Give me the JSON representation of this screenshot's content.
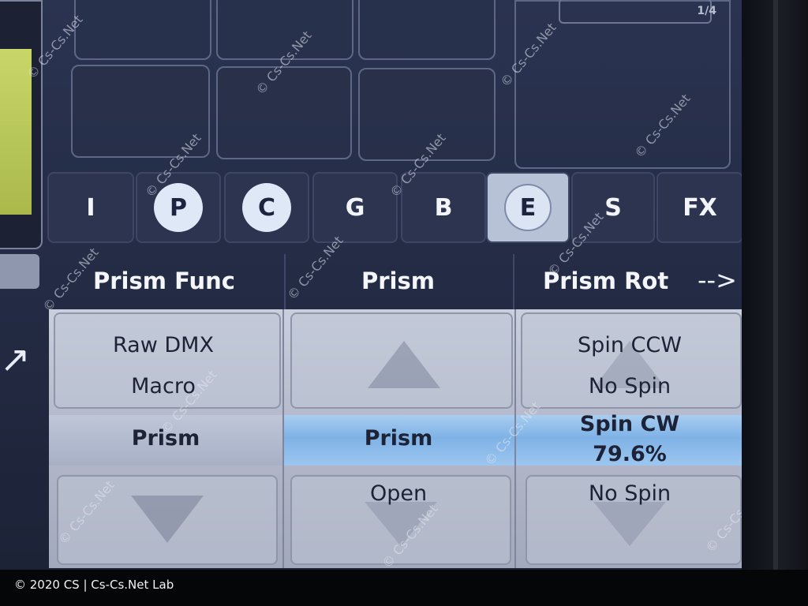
{
  "page_indicator": "1/4",
  "tabs": [
    {
      "label": "I",
      "circled": false,
      "active": false
    },
    {
      "label": "P",
      "circled": true,
      "active": false
    },
    {
      "label": "C",
      "circled": true,
      "active": false
    },
    {
      "label": "G",
      "circled": false,
      "active": false
    },
    {
      "label": "B",
      "circled": false,
      "active": false
    },
    {
      "label": "E",
      "circled": true,
      "active": true
    },
    {
      "label": "S",
      "circled": false,
      "active": false
    },
    {
      "label": "FX",
      "circled": false,
      "active": false
    }
  ],
  "columns": [
    {
      "header": "Prism Func",
      "above2": "Raw DMX",
      "above1": "Macro",
      "selected": "Prism",
      "below1": ""
    },
    {
      "header": "Prism",
      "above2": "",
      "above1": "",
      "selected": "Prism",
      "below1": "Open"
    },
    {
      "header": "Prism Rot",
      "above2": "Spin CCW",
      "above1": "No Spin",
      "selected": "Spin CW",
      "selected_value": "79.6%",
      "below1": "No Spin"
    }
  ],
  "next_arrow": "-->",
  "watermark": "© Cs-Cs.Net",
  "footer": "© 2020 CS | Cs-Cs.Net Lab",
  "colors": {
    "screen_bg": "#252d47",
    "selected_row": "#7fb2e6",
    "table_bg": "#b6bccd"
  }
}
